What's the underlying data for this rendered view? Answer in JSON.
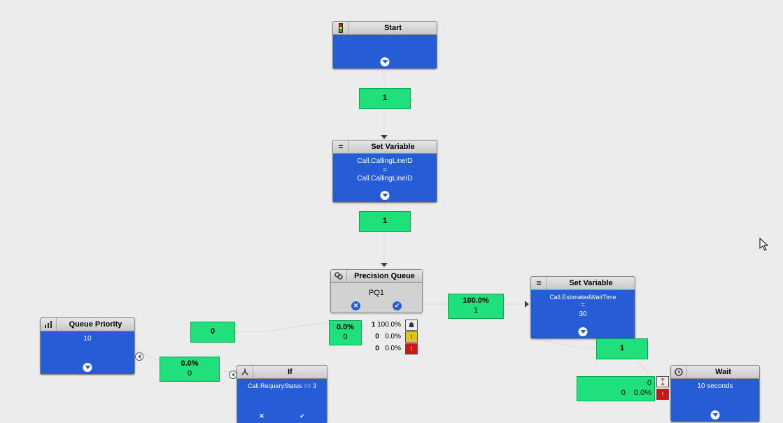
{
  "nodes": {
    "start": {
      "title": "Start"
    },
    "setvar1": {
      "title": "Set Variable",
      "line1": "Call.CallingLineID",
      "line2": "=",
      "line3": "Call.CallingLineID"
    },
    "pq": {
      "title": "Precision Queue",
      "body": "PQ1"
    },
    "setvar2": {
      "title": "Set Variable",
      "line1": "Call.EstimatedWaitTime",
      "line2": "=",
      "line3": "30"
    },
    "wait": {
      "title": "Wait",
      "body": "10 seconds"
    },
    "qprio": {
      "title": "Queue Priority",
      "body": "10"
    },
    "ifnode": {
      "title": "If",
      "body": "Call.RequeryStatus == 3"
    }
  },
  "stats": {
    "start_out": "1",
    "setvar1_out": "1",
    "pq_success": {
      "pct": "100.0%",
      "cnt": "1"
    },
    "pq_left": {
      "pct": "0.0%",
      "cnt": "0"
    },
    "pq_fail": "0",
    "pq_ports": [
      {
        "cnt": "1",
        "pct": "100.0%"
      },
      {
        "cnt": "0",
        "pct": "0.0%"
      },
      {
        "cnt": "0",
        "pct": "0.0%"
      }
    ],
    "setvar2_out": "1",
    "wait_rows": [
      {
        "cnt": "0",
        "pct": ""
      },
      {
        "cnt": "0",
        "pct": "0.0%"
      }
    ],
    "qprio_out": {
      "pct": "0.0%",
      "cnt": "0"
    }
  }
}
